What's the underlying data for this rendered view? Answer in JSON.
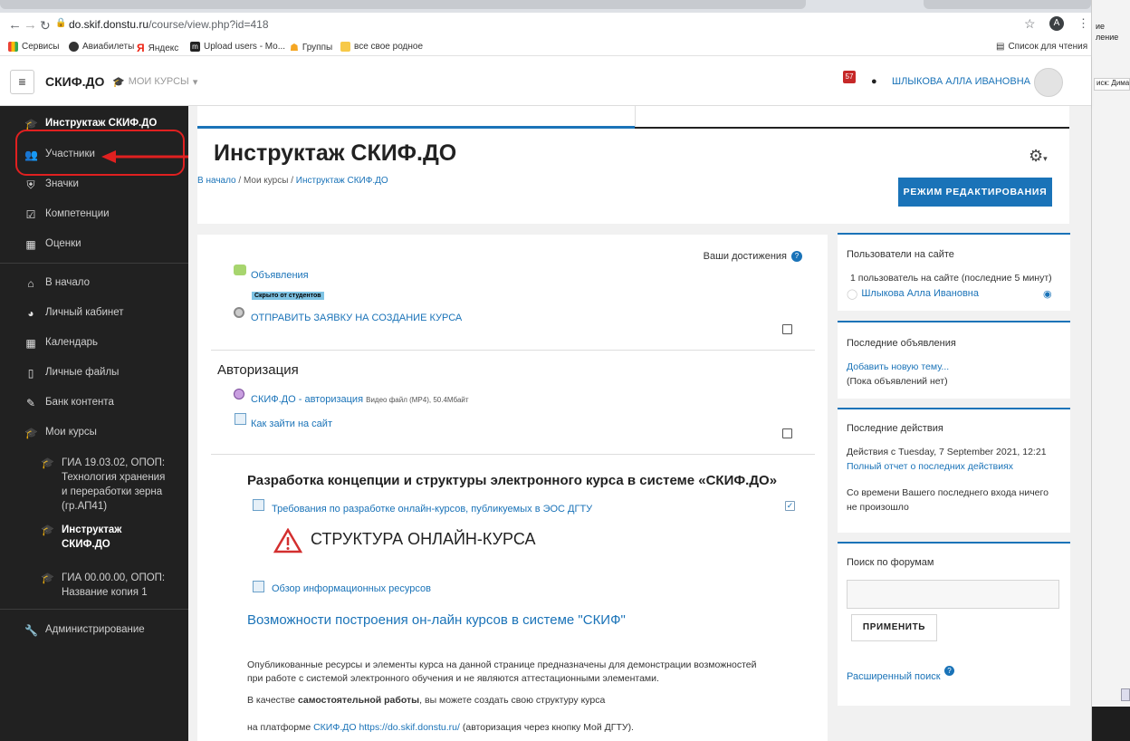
{
  "browser": {
    "url_host": "do.skif.donstu.ru",
    "url_path": "/course/view.php?id=418",
    "avatar_letter": "A",
    "reading_list": "Список для чтения",
    "bookmarks": [
      "Сервисы",
      "Авиабилеты",
      "Яндекс",
      "Upload users - Mo...",
      "Группы",
      "все свое родное"
    ]
  },
  "side_panel": {
    "line1": "ие",
    "line2": "ление",
    "search": "иск: Дима"
  },
  "navbar": {
    "brand": "СКИФ.ДО",
    "my_courses": "МОИ КУРСЫ",
    "notif_count": "57",
    "user_name": "ШЛЫКОВА АЛЛА ИВАНОВНА"
  },
  "drawer": {
    "course": "Инструктаж СКИФ.ДО",
    "items": [
      "Участники",
      "Значки",
      "Компетенции",
      "Оценки"
    ],
    "nav": [
      "В начало",
      "Личный кабинет",
      "Календарь",
      "Личные файлы",
      "Банк контента",
      "Мои курсы"
    ],
    "courses": [
      {
        "name1": "ГИА 19.03.02, ОПОП:",
        "name2": "Технология хранения",
        "name3": "и переработки зерна",
        "name4": "(гр.АП41)"
      },
      {
        "name1": "Инструктаж",
        "name2": "СКИФ.ДО"
      },
      {
        "name1": "ГИА 00.00.00, ОПОП:",
        "name2": "Название копия 1"
      }
    ],
    "admin": "Администрирование"
  },
  "header": {
    "title": "Инструктаж СКИФ.ДО",
    "crumb1": "В начало",
    "sep": "/",
    "crumb2": "Мои курсы",
    "crumb3": "Инструктаж СКИФ.ДО",
    "edit_button": "РЕЖИМ РЕДАКТИРОВАНИЯ"
  },
  "course": {
    "achievements": "Ваши достижения",
    "announcements": "Объявления",
    "hidden_badge": "Скрыто от студентов",
    "send_request": "ОТПРАВИТЬ ЗАЯВКУ НА СОЗДАНИЕ КУРСА",
    "auth_section": "Авторизация",
    "auth_video": "СКИФ.ДО - авторизация",
    "auth_video_meta": "Видео файл (MP4), 50.4Мбайт",
    "how_to": "Как зайти на сайт",
    "dev_title": "Разработка концепции и структуры электронного курса в системе «СКИФ.ДО»",
    "requirements": "Требования по разработке онлайн-курсов, публикуемых в ЭОС ДГТУ",
    "structure": "СТРУКТУРА ОНЛАЙН-КУРСА",
    "overview": "Обзор информационных ресурсов",
    "possibilities": "Возможности построения он-лайн курсов в системе \"СКИФ\"",
    "para1a": "Опубликованные ресурсы и элементы курса на данной странице предназначены для демонстрации возможностей",
    "para1b": "при работе с системой электронного обучения и не являются аттестационными элементами.",
    "para2a": "В качестве ",
    "para2b": "самостоятельной работы",
    "para2c": ", вы можете создать свою структуру курса",
    "para3a": "на платформе ",
    "para3b": "СКИФ.ДО",
    "para3c": "https://do.skif.donstu.ru/",
    "para3d": " (авторизация через кнопку Мой ДГТУ)."
  },
  "blocks": {
    "online_title": "Пользователи на сайте",
    "online_text": "1 пользователь на сайте (последние 5 минут)",
    "online_user": "Шлыкова Алла Ивановна",
    "news_title": "Последние объявления",
    "news_add": "Добавить новую тему...",
    "news_none": "(Пока объявлений нет)",
    "recent_title": "Последние действия",
    "recent_since": "Действия с Tuesday, 7 September 2021, 12:21",
    "recent_full": "Полный отчет о последних действиях",
    "recent_none1": "Со времени Вашего последнего входа ничего",
    "recent_none2": "не произошло",
    "search_title": "Поиск по форумам",
    "search_button": "ПРИМЕНИТЬ",
    "advanced": "Расширенный поиск"
  }
}
